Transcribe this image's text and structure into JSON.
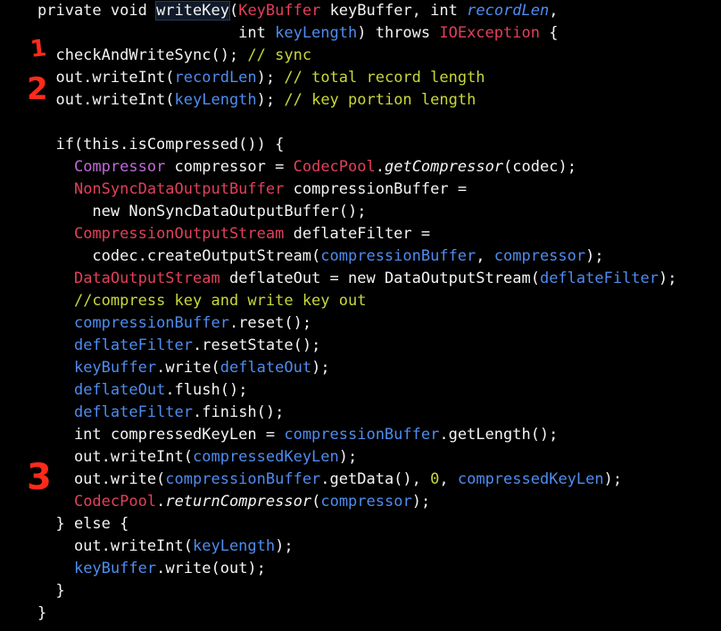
{
  "editor": {
    "colors": {
      "background": "#000000",
      "plain": "#f4f4f4",
      "type": "#e2405a",
      "variable": "#4f8cf0",
      "comment": "#c8d83a",
      "annotation": "#ff2a1a"
    },
    "annotations": [
      {
        "id": "marker-1",
        "text": "1"
      },
      {
        "id": "marker-2",
        "text": "2"
      },
      {
        "id": "marker-3",
        "text": "3"
      }
    ],
    "lines": [
      [
        {
          "t": "private void ",
          "c": "plain"
        },
        {
          "t": "writeKey",
          "c": "plain",
          "hl": true
        },
        {
          "t": "(",
          "c": "plain"
        },
        {
          "t": "KeyBuffer",
          "c": "type"
        },
        {
          "t": " keyBuffer, ",
          "c": "plain"
        },
        {
          "t": "int",
          "c": "plain"
        },
        {
          "t": " ",
          "c": "plain"
        },
        {
          "t": "recordLen",
          "c": "var",
          "i": true
        },
        {
          "t": ",",
          "c": "plain"
        }
      ],
      [
        {
          "t": "                      int ",
          "c": "plain"
        },
        {
          "t": "keyLength",
          "c": "var"
        },
        {
          "t": ") throws ",
          "c": "plain"
        },
        {
          "t": "IOException",
          "c": "type"
        },
        {
          "t": " {",
          "c": "plain"
        }
      ],
      [
        {
          "t": "  checkAndWriteSync(); ",
          "c": "plain"
        },
        {
          "t": "// sync",
          "c": "comment"
        }
      ],
      [
        {
          "t": "  out.writeInt(",
          "c": "plain"
        },
        {
          "t": "recordLen",
          "c": "var"
        },
        {
          "t": "); ",
          "c": "plain"
        },
        {
          "t": "// total record length",
          "c": "comment"
        }
      ],
      [
        {
          "t": "  out.writeInt(",
          "c": "plain"
        },
        {
          "t": "keyLength",
          "c": "var"
        },
        {
          "t": "); ",
          "c": "plain"
        },
        {
          "t": "// key portion length",
          "c": "comment"
        }
      ],
      [
        {
          "t": "",
          "c": "plain"
        }
      ],
      [
        {
          "t": "  if(this.isCompressed()) {",
          "c": "plain"
        }
      ],
      [
        {
          "t": "    ",
          "c": "plain"
        },
        {
          "t": "Compressor",
          "c": "kw"
        },
        {
          "t": " compressor = ",
          "c": "plain"
        },
        {
          "t": "CodecPool",
          "c": "type"
        },
        {
          "t": ".",
          "c": "plain"
        },
        {
          "t": "getCompressor",
          "c": "plain",
          "i": true
        },
        {
          "t": "(codec);",
          "c": "plain"
        }
      ],
      [
        {
          "t": "    ",
          "c": "plain"
        },
        {
          "t": "NonSyncDataOutputBuffer",
          "c": "type"
        },
        {
          "t": " compressionBuffer =",
          "c": "plain"
        }
      ],
      [
        {
          "t": "      new NonSyncDataOutputBuffer();",
          "c": "plain"
        }
      ],
      [
        {
          "t": "    ",
          "c": "plain"
        },
        {
          "t": "CompressionOutputStream",
          "c": "type"
        },
        {
          "t": " deflateFilter =",
          "c": "plain"
        }
      ],
      [
        {
          "t": "      codec.createOutputStream(",
          "c": "plain"
        },
        {
          "t": "compressionBuffer",
          "c": "var"
        },
        {
          "t": ", ",
          "c": "plain"
        },
        {
          "t": "compressor",
          "c": "var"
        },
        {
          "t": ");",
          "c": "plain"
        }
      ],
      [
        {
          "t": "    ",
          "c": "plain"
        },
        {
          "t": "DataOutputStream",
          "c": "type"
        },
        {
          "t": " deflateOut = new DataOutputStream(",
          "c": "plain"
        },
        {
          "t": "deflateFilter",
          "c": "var"
        },
        {
          "t": ");",
          "c": "plain"
        }
      ],
      [
        {
          "t": "    ",
          "c": "plain"
        },
        {
          "t": "//compress key and write key out",
          "c": "comment"
        }
      ],
      [
        {
          "t": "    ",
          "c": "plain"
        },
        {
          "t": "compressionBuffer",
          "c": "var"
        },
        {
          "t": ".reset();",
          "c": "plain"
        }
      ],
      [
        {
          "t": "    ",
          "c": "plain"
        },
        {
          "t": "deflateFilter",
          "c": "var"
        },
        {
          "t": ".resetState();",
          "c": "plain"
        }
      ],
      [
        {
          "t": "    ",
          "c": "plain"
        },
        {
          "t": "keyBuffer",
          "c": "var"
        },
        {
          "t": ".write(",
          "c": "plain"
        },
        {
          "t": "deflateOut",
          "c": "var"
        },
        {
          "t": ");",
          "c": "plain"
        }
      ],
      [
        {
          "t": "    ",
          "c": "plain"
        },
        {
          "t": "deflateOut",
          "c": "var"
        },
        {
          "t": ".flush();",
          "c": "plain"
        }
      ],
      [
        {
          "t": "    ",
          "c": "plain"
        },
        {
          "t": "deflateFilter",
          "c": "var"
        },
        {
          "t": ".finish();",
          "c": "plain"
        }
      ],
      [
        {
          "t": "    int compressedKeyLen = ",
          "c": "plain"
        },
        {
          "t": "compressionBuffer",
          "c": "var"
        },
        {
          "t": ".getLength();",
          "c": "plain"
        }
      ],
      [
        {
          "t": "    out.writeInt(",
          "c": "plain"
        },
        {
          "t": "compressedKeyLen",
          "c": "var"
        },
        {
          "t": ");",
          "c": "plain"
        }
      ],
      [
        {
          "t": "    out.write(",
          "c": "plain"
        },
        {
          "t": "compressionBuffer",
          "c": "var"
        },
        {
          "t": ".getData(), ",
          "c": "plain"
        },
        {
          "t": "0",
          "c": "comment"
        },
        {
          "t": ", ",
          "c": "plain"
        },
        {
          "t": "compressedKeyLen",
          "c": "var"
        },
        {
          "t": ");",
          "c": "plain"
        }
      ],
      [
        {
          "t": "    ",
          "c": "plain"
        },
        {
          "t": "CodecPool",
          "c": "type"
        },
        {
          "t": ".",
          "c": "plain"
        },
        {
          "t": "returnCompressor",
          "c": "plain",
          "i": true
        },
        {
          "t": "(",
          "c": "plain"
        },
        {
          "t": "compressor",
          "c": "var"
        },
        {
          "t": ");",
          "c": "plain"
        }
      ],
      [
        {
          "t": "  } else {",
          "c": "plain"
        }
      ],
      [
        {
          "t": "    out.writeInt(",
          "c": "plain"
        },
        {
          "t": "keyLength",
          "c": "var"
        },
        {
          "t": ");",
          "c": "plain"
        }
      ],
      [
        {
          "t": "    ",
          "c": "plain"
        },
        {
          "t": "keyBuffer",
          "c": "var"
        },
        {
          "t": ".write(out);",
          "c": "plain"
        }
      ],
      [
        {
          "t": "  }",
          "c": "plain"
        }
      ],
      [
        {
          "t": "}",
          "c": "plain"
        }
      ]
    ]
  }
}
